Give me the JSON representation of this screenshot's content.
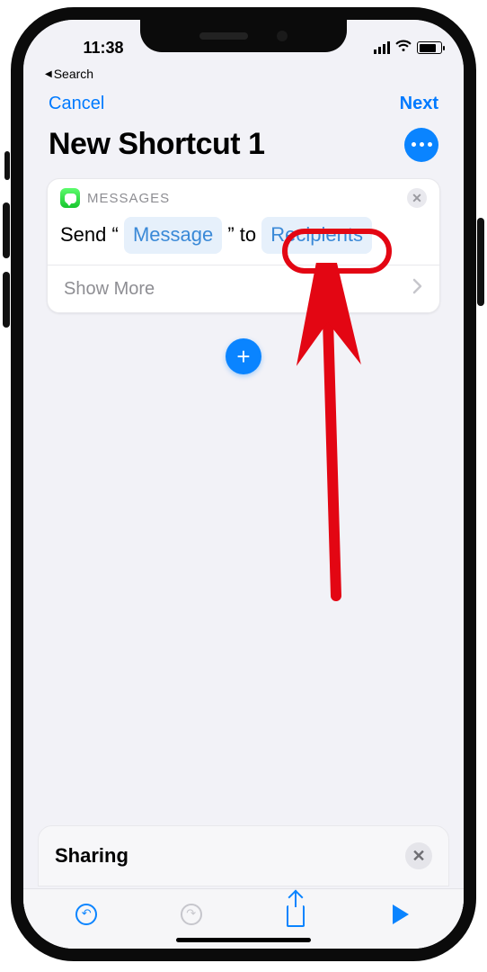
{
  "status": {
    "time": "11:38",
    "back_app": "Search"
  },
  "nav": {
    "cancel": "Cancel",
    "next": "Next"
  },
  "title": "New Shortcut 1",
  "action": {
    "app_label": "MESSAGES",
    "prefix": "Send “",
    "message_token": "Message",
    "mid": "” to",
    "recipients_token": "Recipients",
    "show_more": "Show More"
  },
  "sharing": {
    "label": "Sharing"
  }
}
